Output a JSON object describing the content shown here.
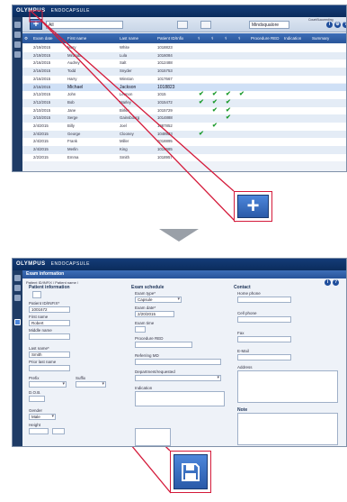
{
  "app": {
    "title": "OLYMPUS",
    "subtitle": "ENDOCAPSULE"
  },
  "list_screen": {
    "filter_value": "All",
    "filter_right_value": "Mindsqualore",
    "corner_label": "CountSucceeding",
    "columns": [
      "Exam date",
      "First name",
      "Last name",
      "Patient ID/Infix",
      "Procedure RED",
      "Indication",
      "Summary"
    ],
    "rows": [
      {
        "date": "2/19/2015",
        "first": "Mary",
        "last": "White",
        "pid": "1018823",
        "c1": false,
        "c2": false,
        "c3": false,
        "c4": false
      },
      {
        "date": "2/19/2015",
        "first": "Miranda",
        "last": "Lula",
        "pid": "1016084",
        "c1": false,
        "c2": false,
        "c3": false,
        "c4": false
      },
      {
        "date": "2/16/2015",
        "first": "Audrey",
        "last": "Salt",
        "pid": "1012488",
        "c1": false,
        "c2": false,
        "c3": false,
        "c4": false
      },
      {
        "date": "2/16/2015",
        "first": "Todd",
        "last": "Snyder",
        "pid": "1015753",
        "c1": false,
        "c2": false,
        "c3": false,
        "c4": false
      },
      {
        "date": "2/16/2015",
        "first": "Harry",
        "last": "Winston",
        "pid": "1017667",
        "c1": false,
        "c2": false,
        "c3": false,
        "c4": false
      },
      {
        "date": "2/16/2015",
        "first": "Michael",
        "last": "Jackson",
        "pid": "1018823",
        "c1": false,
        "c2": false,
        "c3": false,
        "c4": false
      },
      {
        "date": "2/12/2015",
        "first": "John",
        "last": "Lennon",
        "pid": "1015",
        "c1": true,
        "c2": true,
        "c3": true,
        "c4": true
      },
      {
        "date": "2/12/2015",
        "first": "Bob",
        "last": "Marley",
        "pid": "1015472",
        "c1": true,
        "c2": true,
        "c3": true,
        "c4": false
      },
      {
        "date": "2/10/2015",
        "first": "Jane",
        "last": "Birkin",
        "pid": "1015729",
        "c1": false,
        "c2": true,
        "c3": true,
        "c4": false
      },
      {
        "date": "2/10/2015",
        "first": "Serge",
        "last": "Gainsbourg",
        "pid": "1014888",
        "c1": false,
        "c2": false,
        "c3": true,
        "c4": false
      },
      {
        "date": "2/4/2015",
        "first": "Billy",
        "last": "Joel",
        "pid": "1087852",
        "c1": false,
        "c2": true,
        "c3": false,
        "c4": false
      },
      {
        "date": "2/4/2015",
        "first": "George",
        "last": "Clooney",
        "pid": "1048923",
        "c1": true,
        "c2": false,
        "c3": false,
        "c4": false
      },
      {
        "date": "2/4/2015",
        "first": "Frank",
        "last": "Miller",
        "pid": "1018895",
        "c1": false,
        "c2": false,
        "c3": false,
        "c4": false
      },
      {
        "date": "2/4/2015",
        "first": "Merlin",
        "last": "King",
        "pid": "1019985",
        "c1": false,
        "c2": false,
        "c3": false,
        "c4": false
      },
      {
        "date": "2/2/2015",
        "first": "Emma",
        "last": "Smith",
        "pid": "1018957",
        "c1": false,
        "c2": false,
        "c3": false,
        "c4": false
      }
    ]
  },
  "form_screen": {
    "section_title": "Exam information",
    "breadcrumb": "Patient ID/INFIX / Patient name /",
    "patient_info": {
      "header": "Patient information",
      "patient_id_label": "Patient ID/INFIX*",
      "patient_id_value": "1001672",
      "first_name_label": "First name",
      "first_name_value": "Robert",
      "middle_name_label": "Middle name",
      "last_name_label": "Last name*",
      "last_name_value": "Smith",
      "prior_last_name_label": "Prior last name",
      "prefix_label": "Prefix",
      "suffix_label": "Suffix",
      "dob_label": "D.O.B.",
      "gender_label": "Gender",
      "gender_value": "Male",
      "height_label": "Height"
    },
    "exam_schedule": {
      "header": "Exam schedule",
      "exam_type_label": "Exam type*",
      "exam_type_value": "Capsule",
      "exam_date_label": "Exam date*",
      "exam_date_value": "2/20/2015",
      "exam_time_label": "Exam time",
      "procedure_label": "Procedure RED",
      "referring_label": "Referring MD",
      "department_label": "Department/requested",
      "indication_label": "Indication"
    },
    "contact": {
      "header": "Contact",
      "home_phone_label": "Home phone",
      "cell_phone_label": "Cell phone",
      "fax_label": "Fax",
      "email_label": "E-Mail",
      "address_label": "Address",
      "note_label": "Note"
    }
  },
  "zoom_add_icon": "plus-icon",
  "zoom_save_icon": "floppy-disk-icon",
  "colors": {
    "accent": "#2e5fa9",
    "highlight": "#d41a3a",
    "titlebar": "#0b2c5c"
  }
}
